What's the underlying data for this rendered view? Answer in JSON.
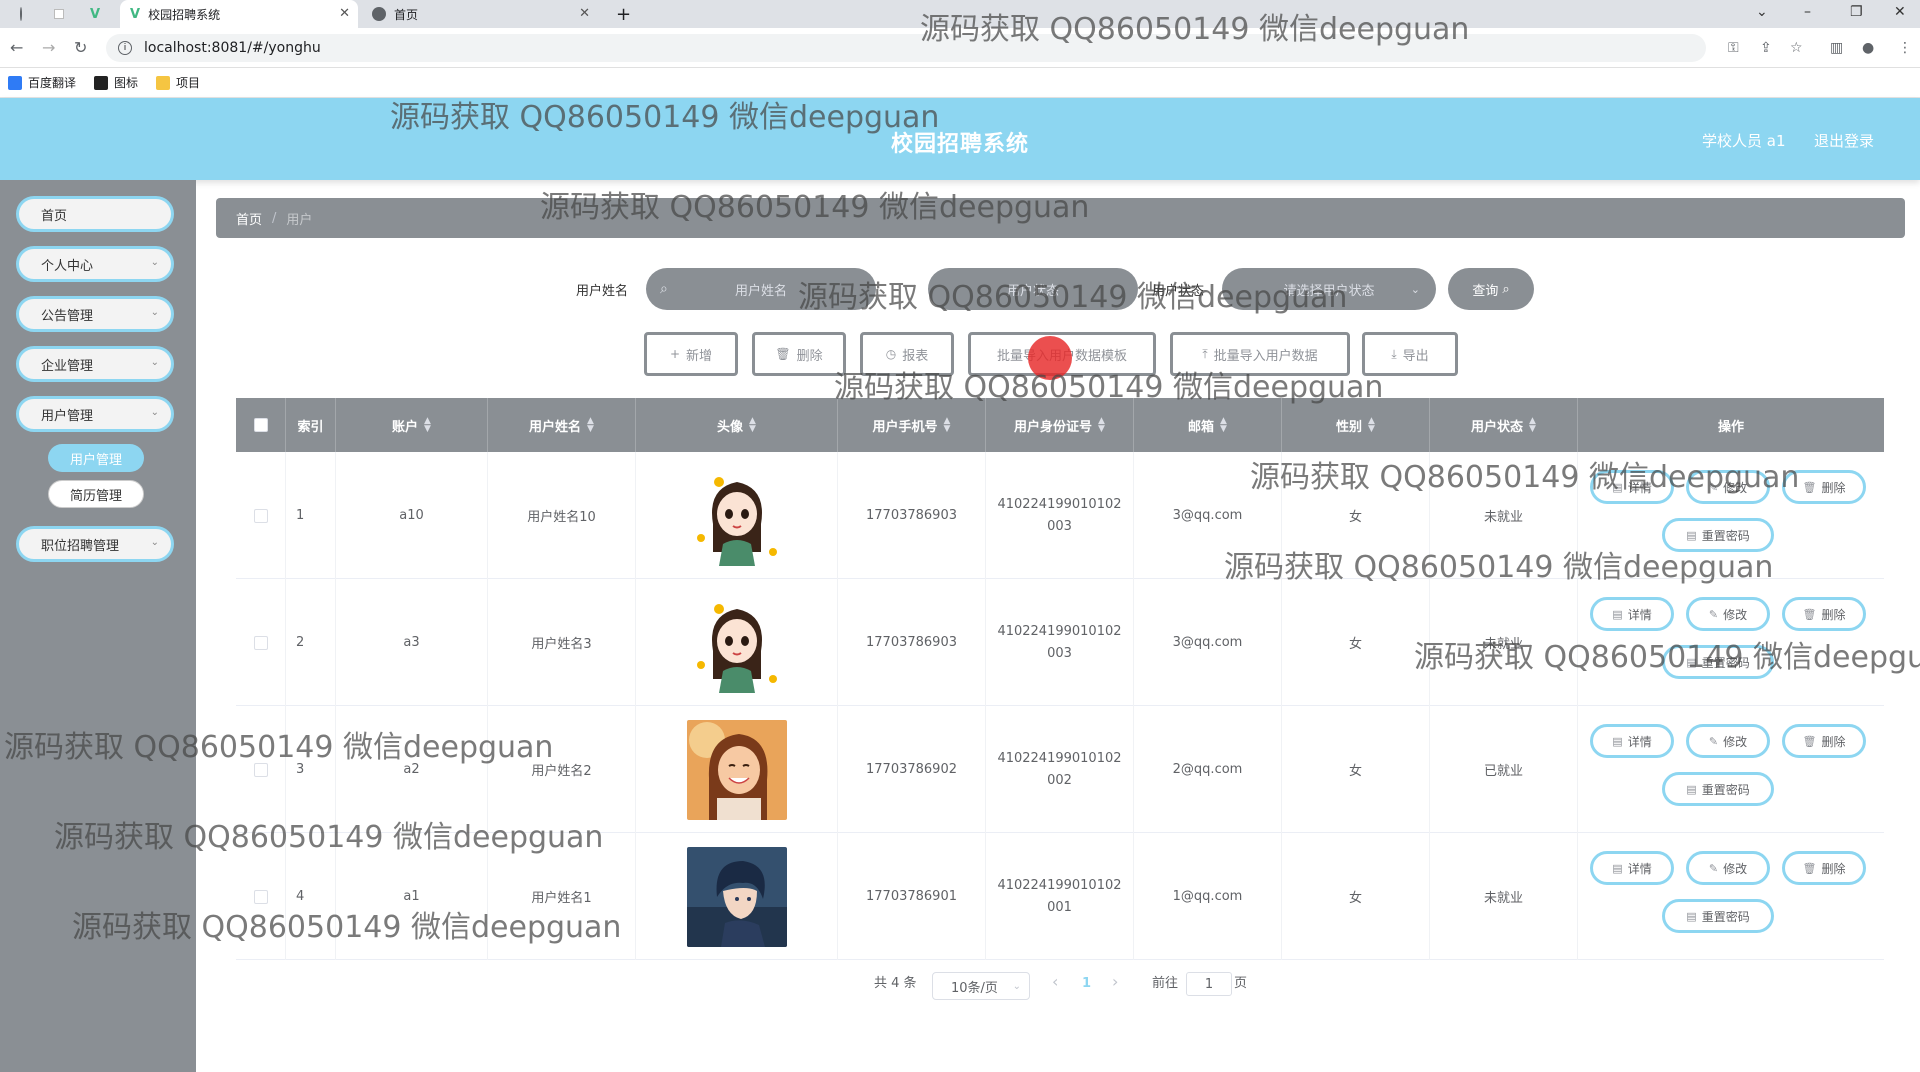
{
  "browser": {
    "tabs": [
      {
        "label": "校园招聘系统",
        "active": true
      },
      {
        "label": "首页",
        "active": false
      }
    ],
    "new_tab": "+",
    "url": "localhost:8081/#/yonghu",
    "bookmarks": [
      "百度翻译",
      "图标",
      "项目"
    ]
  },
  "header": {
    "title": "校园招聘系统",
    "user_label": "学校人员 a1",
    "logout": "退出登录"
  },
  "sidebar": {
    "items": [
      {
        "label": "首页",
        "has_children": false
      },
      {
        "label": "个人中心",
        "has_children": true
      },
      {
        "label": "公告管理",
        "has_children": true
      },
      {
        "label": "企业管理",
        "has_children": true
      },
      {
        "label": "用户管理",
        "has_children": true
      },
      {
        "label": "职位招聘管理",
        "has_children": true
      }
    ],
    "sub_items": [
      {
        "label": "用户管理",
        "active": true
      },
      {
        "label": "简历管理",
        "active": false
      }
    ]
  },
  "breadcrumb": {
    "home": "首页",
    "separator": "/",
    "current": "用户"
  },
  "search": {
    "name_label": "用户姓名",
    "name_placeholder": "用户姓名",
    "field2_label": "用户状态",
    "field2_placeholder": "用户状态",
    "state_label": "用户状态",
    "state_placeholder": "请选择用户状态",
    "query_button": "查询"
  },
  "actions": {
    "add": "新增",
    "delete": "删除",
    "report": "报表",
    "template": "批量导入用户数据模板",
    "import": "批量导入用户数据",
    "export": "导出"
  },
  "table": {
    "headers": [
      "索引",
      "账户",
      "用户姓名",
      "头像",
      "用户手机号",
      "用户身份证号",
      "邮箱",
      "性别",
      "用户状态",
      "操作"
    ],
    "rows": [
      {
        "index": "1",
        "account": "a10",
        "name": "用户姓名10",
        "avatar": "cartoon-girl",
        "phone": "17703786903",
        "id_line1": "410224199010102",
        "id_line2": "003",
        "email": "3@qq.com",
        "gender": "女",
        "status": "未就业"
      },
      {
        "index": "2",
        "account": "a3",
        "name": "用户姓名3",
        "avatar": "cartoon-girl",
        "phone": "17703786903",
        "id_line1": "410224199010102",
        "id_line2": "003",
        "email": "3@qq.com",
        "gender": "女",
        "status": "未就业"
      },
      {
        "index": "3",
        "account": "a2",
        "name": "用户姓名2",
        "avatar": "smiling-woman",
        "phone": "17703786902",
        "id_line1": "410224199010102",
        "id_line2": "002",
        "email": "2@qq.com",
        "gender": "女",
        "status": "已就业"
      },
      {
        "index": "4",
        "account": "a1",
        "name": "用户姓名1",
        "avatar": "anime-boy",
        "phone": "17703786901",
        "id_line1": "410224199010102",
        "id_line2": "001",
        "email": "1@qq.com",
        "gender": "女",
        "status": "未就业"
      }
    ],
    "row_ops": {
      "detail": "详情",
      "edit": "修改",
      "delete": "删除",
      "reset_pwd": "重置密码"
    }
  },
  "pagination": {
    "total": "共 4 条",
    "page_size": "10条/页",
    "prev": "‹",
    "current": "1",
    "next": "›",
    "goto_label": "前往",
    "goto_value": "1",
    "page_suffix": "页"
  },
  "watermark": "源码获取 QQ86050149 微信deepguan",
  "colors": {
    "accent": "#8dd6f1",
    "gray": "#8a8f94"
  }
}
